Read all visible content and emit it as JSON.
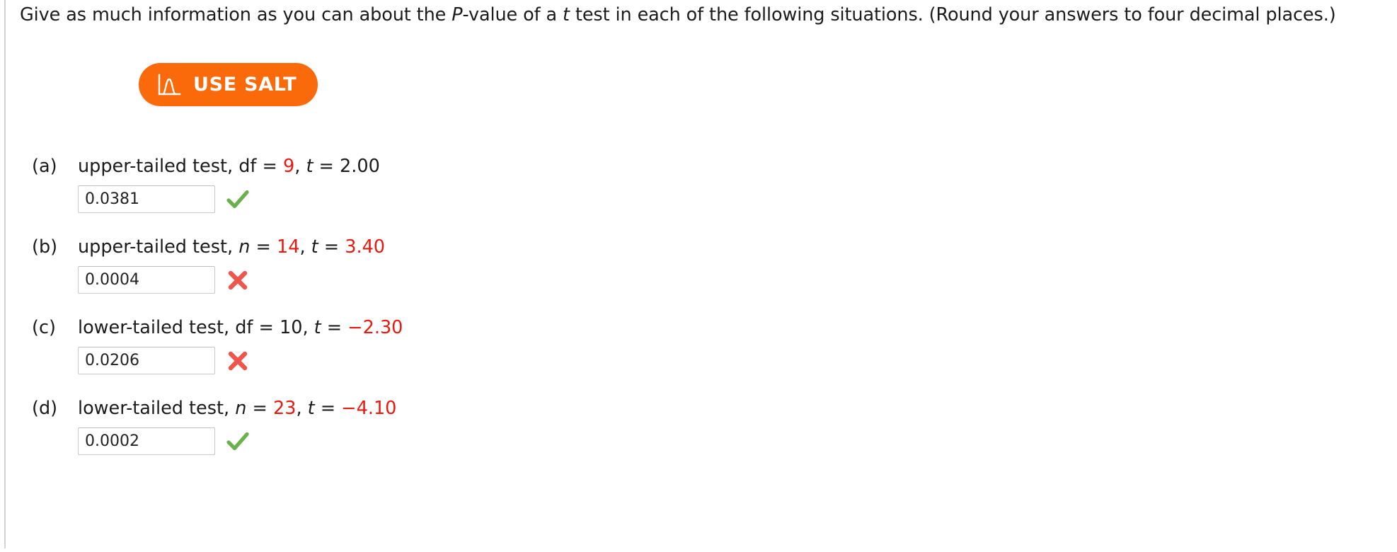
{
  "prompt": {
    "before_p": "Give as much information as you can about the ",
    "p_italic": "P",
    "after_p": "-value of a ",
    "t_italic": "t",
    "tail": " test in each of the following situations. (Round your answers to four decimal places.)"
  },
  "salt_button": {
    "label": "USE SALT",
    "icon": "distribution-curve-icon",
    "background_color": "#fa6a0a",
    "text_color": "#ffffff"
  },
  "colors": {
    "highlight_red": "#e8190f",
    "correct_green": "#6ab04c",
    "incorrect_red": "#f0544a",
    "text": "#1b1b1b",
    "input_border": "#c9c9c9",
    "rule": "#d2d2d2"
  },
  "parts": [
    {
      "label": "(a)",
      "tail_type": "upper-tailed test, ",
      "param_name": "df",
      "param_italic": false,
      "eq1": " = ",
      "param_value": "9",
      "param_value_highlight": true,
      "comma": ", ",
      "t_symbol": "t",
      "eq2": " = ",
      "t_value": "2.00",
      "t_value_highlight": false,
      "answer": "0.0381",
      "answer_placeholder": "",
      "status": "correct",
      "status_icon": "green-check-icon"
    },
    {
      "label": "(b)",
      "tail_type": "upper-tailed test, ",
      "param_name": "n",
      "param_italic": true,
      "eq1": " = ",
      "param_value": "14",
      "param_value_highlight": true,
      "comma": ", ",
      "t_symbol": "t",
      "eq2": " = ",
      "t_value": "3.40",
      "t_value_highlight": true,
      "answer": "0.0004",
      "answer_placeholder": "",
      "status": "incorrect",
      "status_icon": "red-cross-icon"
    },
    {
      "label": "(c)",
      "tail_type": "lower-tailed test, ",
      "param_name": "df",
      "param_italic": false,
      "eq1": " = ",
      "param_value": "10",
      "param_value_highlight": false,
      "comma": ", ",
      "t_symbol": "t",
      "eq2": " = ",
      "t_value": "−2.30",
      "t_value_highlight": true,
      "answer": "0.0206",
      "answer_placeholder": "",
      "status": "incorrect",
      "status_icon": "red-cross-icon"
    },
    {
      "label": "(d)",
      "tail_type": "lower-tailed test, ",
      "param_name": "n",
      "param_italic": true,
      "eq1": " = ",
      "param_value": "23",
      "param_value_highlight": true,
      "comma": ", ",
      "t_symbol": "t",
      "eq2": " = ",
      "t_value": "−4.10",
      "t_value_highlight": true,
      "answer": "0.0002",
      "answer_placeholder": "",
      "status": "correct",
      "status_icon": "green-check-icon"
    }
  ]
}
